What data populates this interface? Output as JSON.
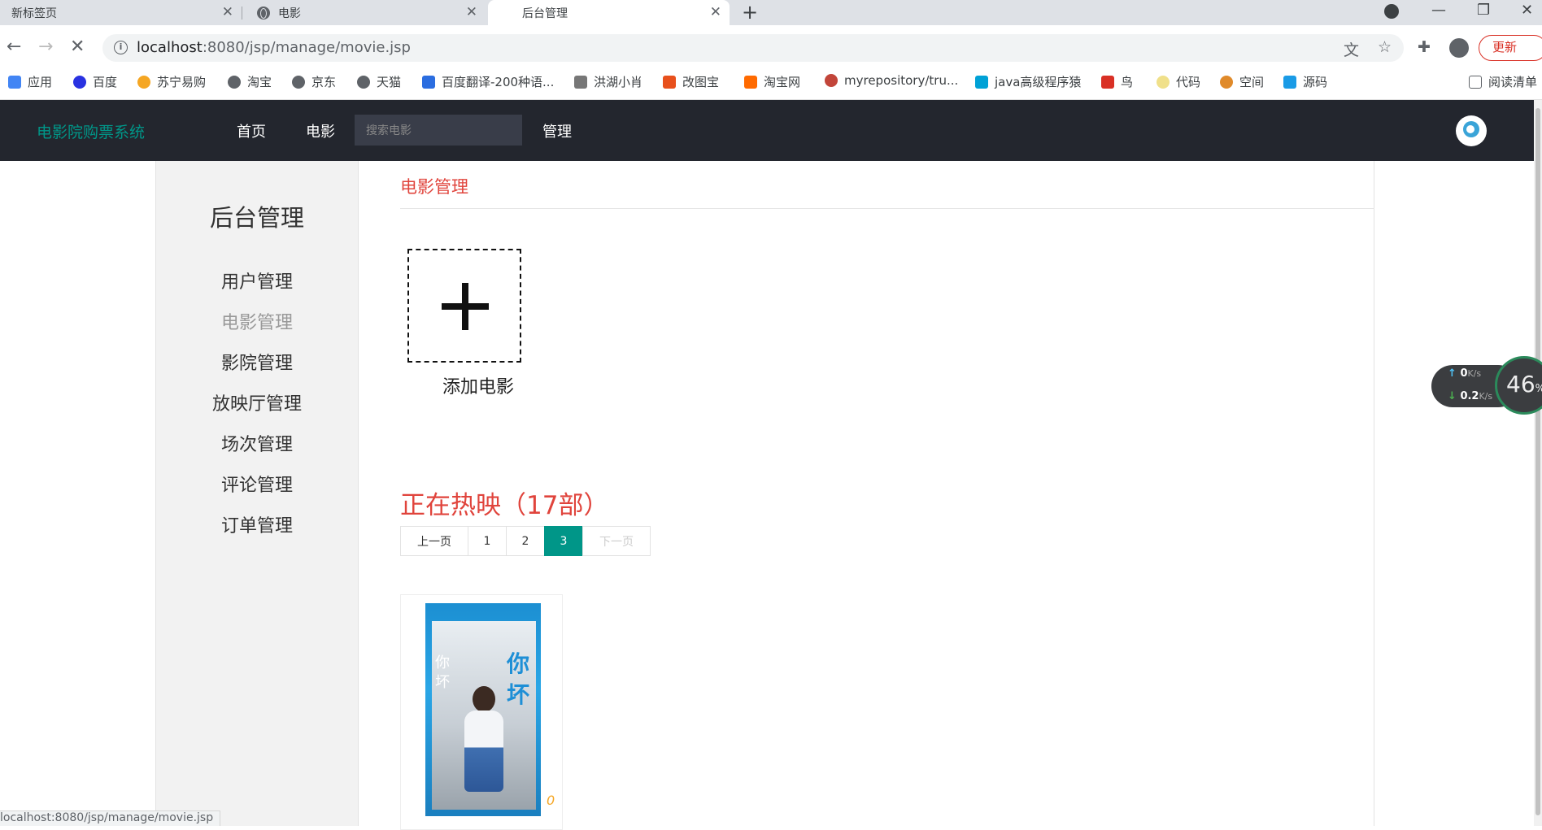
{
  "browser": {
    "tabs": [
      {
        "title": "新标签页"
      },
      {
        "title": "电影"
      },
      {
        "title": "后台管理"
      }
    ],
    "address": {
      "host": "localhost",
      "path": ":8080/jsp/manage/movie.jsp"
    },
    "update_label": "更新",
    "bookmarks": [
      {
        "label": "应用",
        "color": "#4285f4"
      },
      {
        "label": "百度",
        "color": "#2932e1"
      },
      {
        "label": "苏宁易购",
        "color": "#f5a623"
      },
      {
        "label": "淘宝",
        "color": "#5f6368"
      },
      {
        "label": "京东",
        "color": "#5f6368"
      },
      {
        "label": "天猫",
        "color": "#5f6368"
      },
      {
        "label": "百度翻译-200种语...",
        "color": "#2b6de0"
      },
      {
        "label": "洪湖小肖",
        "color": "#777777"
      },
      {
        "label": "改图宝",
        "color": "#e8501c"
      },
      {
        "label": "淘宝网",
        "color": "#ff6a00"
      },
      {
        "label": "myrepository/tru...",
        "color": "#c2453a"
      },
      {
        "label": "java高级程序猿",
        "color": "#00a1d6"
      },
      {
        "label": "鸟",
        "color": "#d93025"
      },
      {
        "label": "代码",
        "color": "#f0e08a"
      },
      {
        "label": "空间",
        "color": "#e08a2a"
      },
      {
        "label": "源码",
        "color": "#1a9be6"
      }
    ],
    "reading_list": "阅读清单",
    "status_url": "localhost:8080/jsp/manage/movie.jsp"
  },
  "site": {
    "brand": "电影院购票系统",
    "nav": [
      {
        "label": "首页"
      },
      {
        "label": "电影"
      },
      {
        "label": "管理"
      }
    ],
    "search_placeholder": "搜索电影"
  },
  "sidebar": {
    "title": "后台管理",
    "items": [
      {
        "label": "用户管理"
      },
      {
        "label": "电影管理"
      },
      {
        "label": "影院管理"
      },
      {
        "label": "放映厅管理"
      },
      {
        "label": "场次管理"
      },
      {
        "label": "评论管理"
      },
      {
        "label": "订单管理"
      }
    ],
    "current": "电影管理"
  },
  "main": {
    "section_title": "电影管理",
    "add_label": "添加电影",
    "hot_title": "正在热映（17部）",
    "pager": {
      "prev": "上一页",
      "pages": [
        "1",
        "2",
        "3"
      ],
      "current": "3",
      "next": "下一页"
    },
    "movie": {
      "poster_title": "你坏",
      "poster_side": "你坏",
      "rating": "0"
    }
  },
  "network_widget": {
    "up_value": "0",
    "down_value": "0.2",
    "unit": "K/s",
    "percent": "46",
    "percent_unit": "%"
  }
}
